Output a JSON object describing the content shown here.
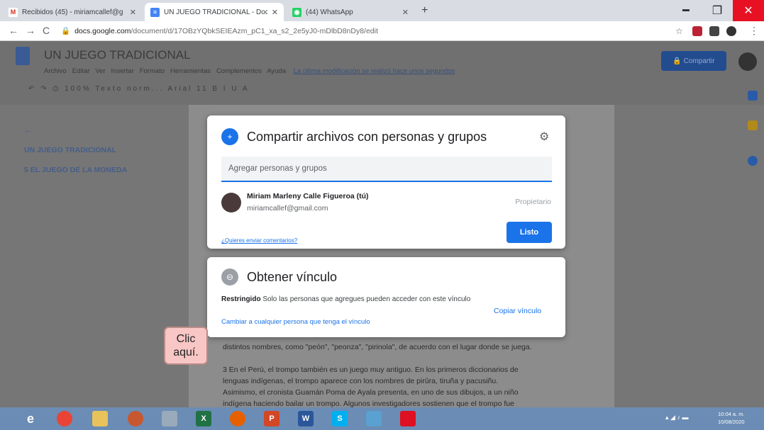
{
  "browser": {
    "tabs": [
      {
        "title": "Recibidos (45) - miriamcallef@g",
        "favicon": "M",
        "favicon_color": "#d93025"
      },
      {
        "title": "UN JUEGO TRADICIONAL - Doc",
        "favicon": "≡",
        "favicon_color": "#4285f4"
      },
      {
        "title": "(44) WhatsApp",
        "favicon": "◉",
        "favicon_color": "#25d366"
      }
    ],
    "url_host": "docs.google.com",
    "url_path": "/document/d/17OBzYQbkSEIEAzm_pC1_xa_s2_2e5yJ0-mDlbD8nDy8/edit"
  },
  "docs": {
    "title": "UN JUEGO TRADICIONAL",
    "menu": [
      "Archivo",
      "Editar",
      "Ver",
      "Insertar",
      "Formato",
      "Herramientas",
      "Complementos",
      "Ayuda"
    ],
    "last_edit": "La última modificación se realizó hace unos segundos",
    "share_label": "Compartir",
    "zoom": "100%",
    "style": "Texto norm...",
    "font": "Arial",
    "font_size": "11",
    "outline": [
      "UN JUEGO TRADICIONAL",
      "5 EL JUEGO DE LA MONEDA"
    ],
    "body_lines": [
      "distintos nombres, como \"peón\", \"peonza\", \"pirinola\", de acuerdo con el lugar donde se juega.",
      "3 En el Perú, el trompo también es un juego muy antiguo. En los primeros diccionarios de",
      "lenguas indígenas, el trompo aparece con los nombres de pirûra, tiruña y pacusiñu.",
      "Asimismo, el cronista Guamán Poma de Ayala presenta, en uno de sus dibujos, a un niño",
      "indígena haciendo bailar un trompo. Algunos investigadores sostienen que el trompo fue"
    ]
  },
  "share_dialog": {
    "title": "Compartir archivos con personas y grupos",
    "input_placeholder": "Agregar personas y grupos",
    "user_name": "Miriam Marleny Calle Figueroa (tú)",
    "user_email": "miriamcallef@gmail.com",
    "user_role": "Propietario",
    "feedback_link": "¿Quieres enviar comentarios?",
    "done_label": "Listo"
  },
  "link_dialog": {
    "title": "Obtener vínculo",
    "restricted_label": "Restringido",
    "restricted_desc": "Solo las personas que agregues pueden acceder con este vínculo",
    "change_link": "Cambiar a cualquier persona que tenga el vínculo",
    "copy_link": "Copiar vínculo"
  },
  "callout": "Clic\naquí.",
  "taskbar": {
    "time": "10:04 a. m.",
    "date": "10/08/2020"
  },
  "colors": {
    "accent": "#1a73e8",
    "close_red": "#e81123"
  }
}
